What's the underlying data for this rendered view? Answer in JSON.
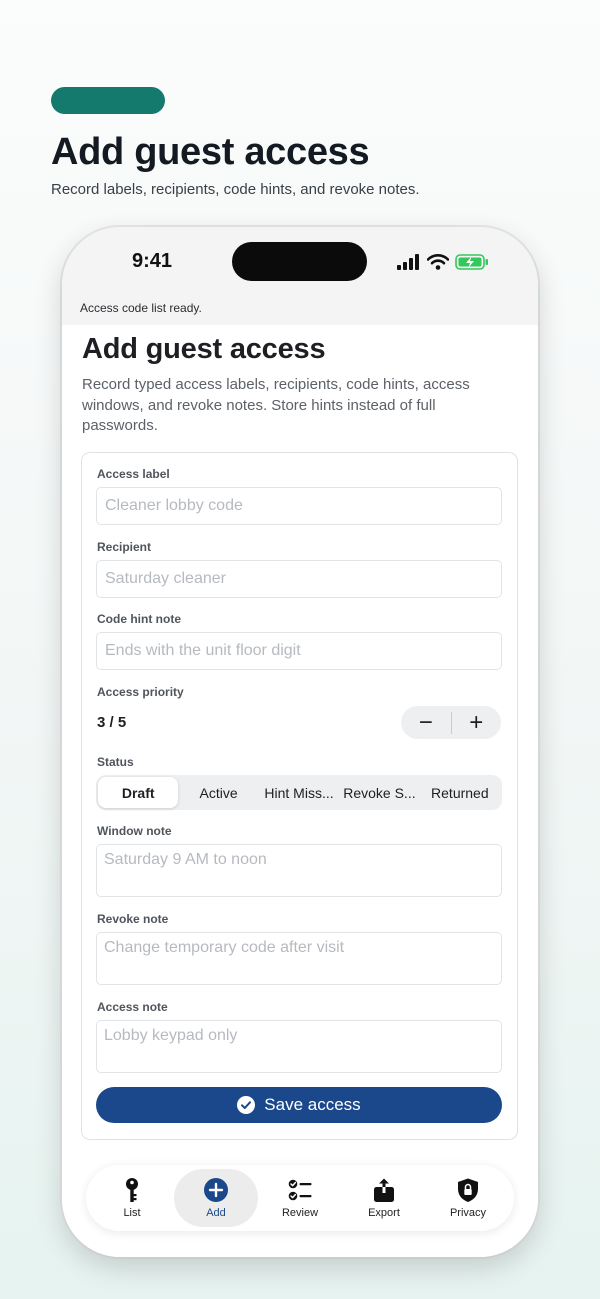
{
  "hero": {
    "title": "Add guest access",
    "subtitle": "Record labels, recipients, code hints, and revoke notes."
  },
  "status_bar": {
    "time": "9:41",
    "banner": "Access code list ready."
  },
  "page": {
    "title": "Add guest access",
    "description": "Record typed access labels, recipients, code hints, access windows, and revoke notes. Store hints instead of full passwords."
  },
  "form": {
    "access_label": {
      "label": "Access label",
      "placeholder": "Cleaner lobby code"
    },
    "recipient": {
      "label": "Recipient",
      "placeholder": "Saturday cleaner"
    },
    "code_hint": {
      "label": "Code hint note",
      "placeholder": "Ends with the unit floor digit"
    },
    "priority": {
      "label": "Access priority",
      "value": "3 / 5",
      "minus": "−",
      "plus": "+"
    },
    "status": {
      "label": "Status",
      "options": [
        "Draft",
        "Active",
        "Hint Miss...",
        "Revoke S...",
        "Returned"
      ],
      "selected": "Draft"
    },
    "window_note": {
      "label": "Window note",
      "placeholder": "Saturday 9 AM to noon"
    },
    "revoke_note": {
      "label": "Revoke note",
      "placeholder": "Change temporary code after visit"
    },
    "access_note": {
      "label": "Access note",
      "placeholder": "Lobby keypad only"
    },
    "save_label": "Save access"
  },
  "tabbar": {
    "items": [
      {
        "label": "List",
        "icon": "key-icon"
      },
      {
        "label": "Add",
        "icon": "plus-circle-icon",
        "active": true
      },
      {
        "label": "Review",
        "icon": "checklist-icon"
      },
      {
        "label": "Export",
        "icon": "share-icon"
      },
      {
        "label": "Privacy",
        "icon": "lock-shield-icon"
      }
    ]
  },
  "colors": {
    "hero_pill": "#157a6e",
    "accent": "#1b478b",
    "battery": "#34c759"
  }
}
